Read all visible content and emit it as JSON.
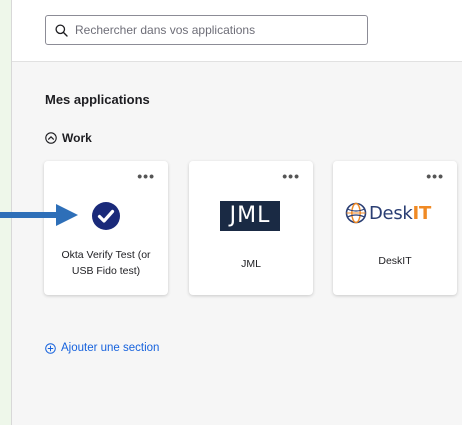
{
  "search": {
    "placeholder": "Rechercher dans vos applications"
  },
  "section": {
    "title": "Mes applications"
  },
  "group": {
    "label": "Work"
  },
  "apps": [
    {
      "name_line1": "Okta Verify Test (or",
      "name_line2": "USB Fido test)",
      "icon": "okta-verify-icon"
    },
    {
      "name": "JML",
      "logo_text": "JML",
      "icon": "jml-logo"
    },
    {
      "name": "DeskIT",
      "logo_text_a": "Desk",
      "logo_text_b": "IT",
      "icon": "deskit-logo"
    }
  ],
  "more_glyph": "•••",
  "add_section": {
    "label": "Ajouter une section"
  },
  "colors": {
    "accent": "#1662dd",
    "arrow": "#2e6fb8",
    "okta_navy": "#1a2a7a",
    "jml_navy": "#1a2a44",
    "deskit_orange": "#f08a24"
  }
}
